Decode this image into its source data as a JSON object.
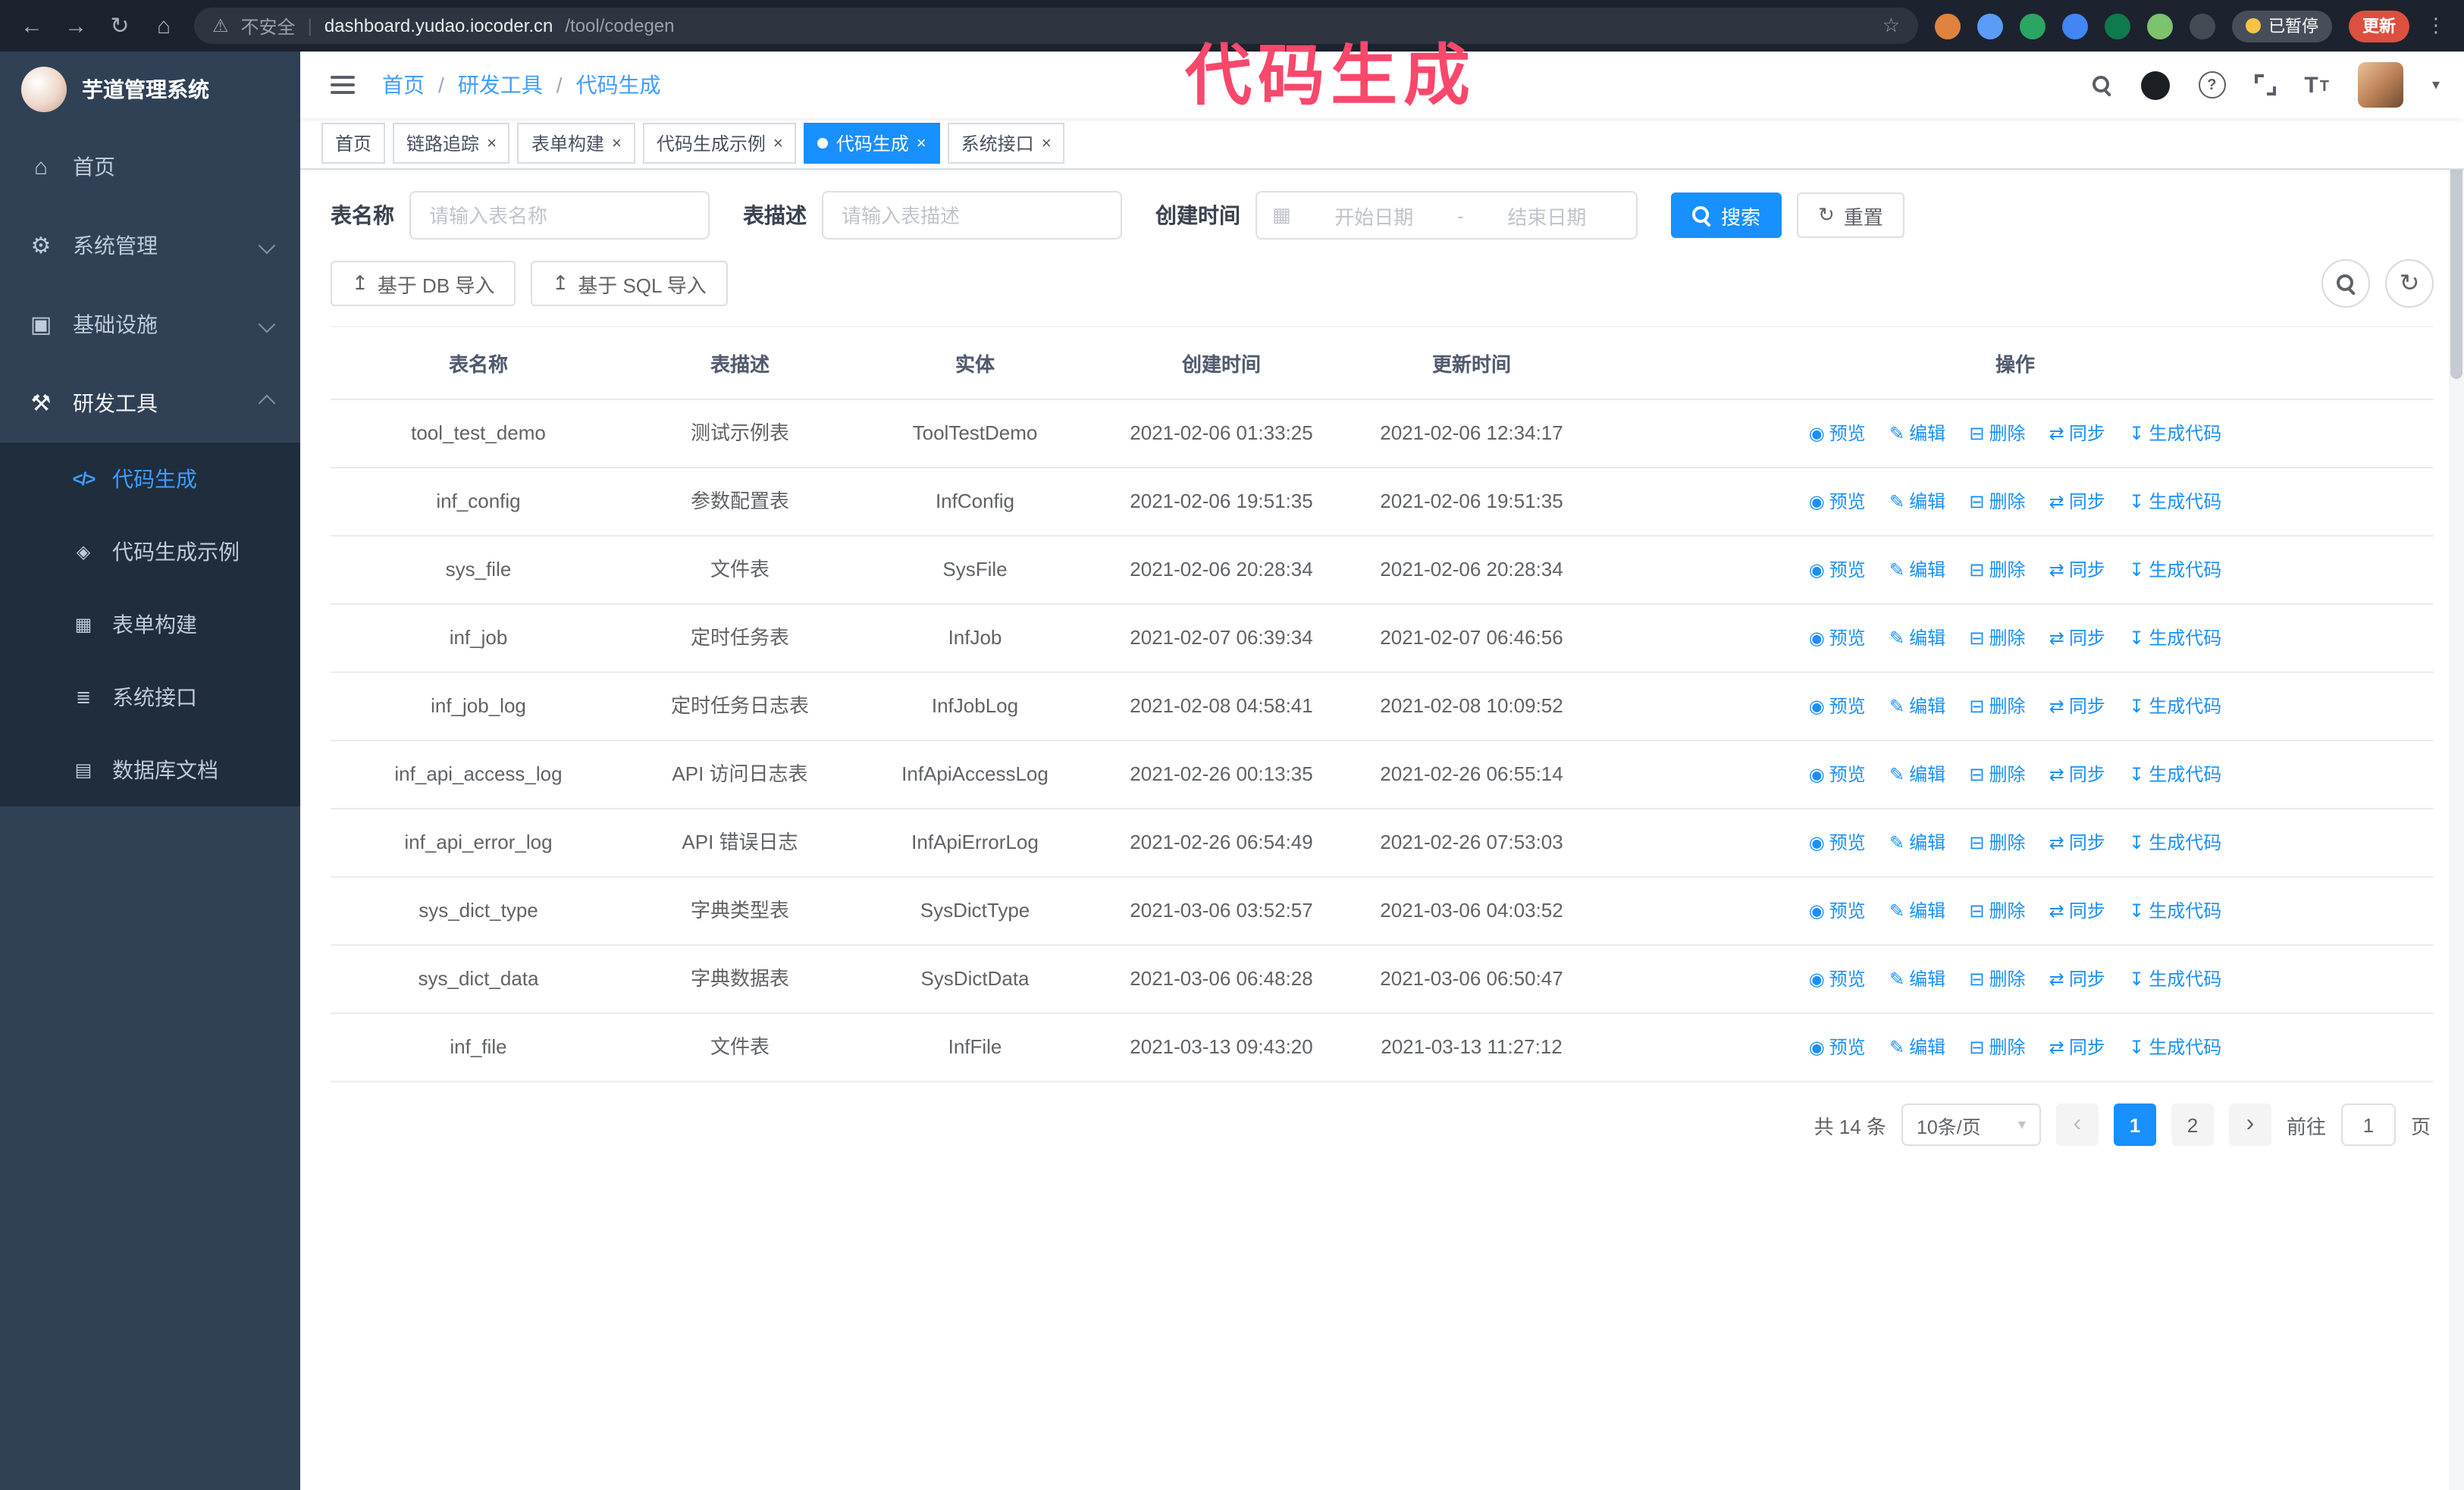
{
  "browser": {
    "security_label": "不安全",
    "url_host": "dashboard.yudao.iocoder.cn",
    "url_path": "/tool/codegen",
    "paused_badge": "已暂停",
    "update_button": "更新"
  },
  "annotation": {
    "text": "代码生成",
    "color": "#f8486c"
  },
  "theme": {
    "accent": "#1890ff",
    "sidebar_bg": "#304156",
    "submenu_bg": "#1f2d3d",
    "link_color": "#409eff",
    "annotation_color": "#f8486c"
  },
  "icons": {
    "back": "←",
    "forward": "→",
    "reload": "↻",
    "home": "⌂",
    "warning": "⚠",
    "star": "☆",
    "kebab": "⋮",
    "close": "×",
    "menu_home": "⌂",
    "menu_system": "⚙",
    "menu_infra": "▣",
    "menu_tools": "⚒",
    "menu_codegen": "</>",
    "menu_example": "◈",
    "menu_form": "▦",
    "menu_api": "≣",
    "menu_db": "▤",
    "calendar": "▦",
    "reset": "↻",
    "import": "↥",
    "refresh": "↻",
    "eye": "◉",
    "edit": "✎",
    "delete": "⊟",
    "sync": "⇄",
    "generate": "↧",
    "caret_down": "▾",
    "prev": "‹",
    "next": "›",
    "question": "?",
    "font_large": "T",
    "font_small": "T"
  },
  "sidebar": {
    "logo_title": "芋道管理系统",
    "items": [
      {
        "label": "首页",
        "expandable": false
      },
      {
        "label": "系统管理",
        "expandable": true,
        "expanded": false
      },
      {
        "label": "基础设施",
        "expandable": true,
        "expanded": false
      },
      {
        "label": "研发工具",
        "expandable": true,
        "expanded": true
      }
    ],
    "sub_items": [
      {
        "label": "代码生成",
        "active": true
      },
      {
        "label": "代码生成示例",
        "active": false
      },
      {
        "label": "表单构建",
        "active": false
      },
      {
        "label": "系统接口",
        "active": false
      },
      {
        "label": "数据库文档",
        "active": false
      }
    ]
  },
  "header": {
    "breadcrumb": [
      "首页",
      "研发工具",
      "代码生成"
    ],
    "separator": "/"
  },
  "tabs": [
    {
      "label": "首页",
      "closable": false,
      "active": false
    },
    {
      "label": "链路追踪",
      "closable": true,
      "active": false
    },
    {
      "label": "表单构建",
      "closable": true,
      "active": false
    },
    {
      "label": "代码生成示例",
      "closable": true,
      "active": false
    },
    {
      "label": "代码生成",
      "closable": true,
      "active": true
    },
    {
      "label": "系统接口",
      "closable": true,
      "active": false
    }
  ],
  "filters": {
    "table_name_label": "表名称",
    "table_name_placeholder": "请输入表名称",
    "table_desc_label": "表描述",
    "table_desc_placeholder": "请输入表描述",
    "create_time_label": "创建时间",
    "date_start_placeholder": "开始日期",
    "date_separator": "-",
    "date_end_placeholder": "结束日期",
    "search_button": "搜索",
    "reset_button": "重置"
  },
  "toolbar": {
    "import_db_button": "基于 DB 导入",
    "import_sql_button": "基于 SQL 导入"
  },
  "table": {
    "columns": [
      "表名称",
      "表描述",
      "实体",
      "创建时间",
      "更新时间",
      "操作"
    ],
    "actions": [
      "预览",
      "编辑",
      "删除",
      "同步",
      "生成代码"
    ],
    "rows": [
      {
        "name": "tool_test_demo",
        "desc": "测试示例表",
        "entity": "ToolTestDemo",
        "created": "2021-02-06 01:33:25",
        "updated": "2021-02-06 12:34:17"
      },
      {
        "name": "inf_config",
        "desc": "参数配置表",
        "entity": "InfConfig",
        "created": "2021-02-06 19:51:35",
        "updated": "2021-02-06 19:51:35"
      },
      {
        "name": "sys_file",
        "desc": "文件表",
        "entity": "SysFile",
        "created": "2021-02-06 20:28:34",
        "updated": "2021-02-06 20:28:34"
      },
      {
        "name": "inf_job",
        "desc": "定时任务表",
        "entity": "InfJob",
        "created": "2021-02-07 06:39:34",
        "updated": "2021-02-07 06:46:56"
      },
      {
        "name": "inf_job_log",
        "desc": "定时任务日志表",
        "entity": "InfJobLog",
        "created": "2021-02-08 04:58:41",
        "updated": "2021-02-08 10:09:52"
      },
      {
        "name": "inf_api_access_log",
        "desc": "API 访问日志表",
        "entity": "InfApiAccessLog",
        "created": "2021-02-26 00:13:35",
        "updated": "2021-02-26 06:55:14"
      },
      {
        "name": "inf_api_error_log",
        "desc": "API 错误日志",
        "entity": "InfApiErrorLog",
        "created": "2021-02-26 06:54:49",
        "updated": "2021-02-26 07:53:03"
      },
      {
        "name": "sys_dict_type",
        "desc": "字典类型表",
        "entity": "SysDictType",
        "created": "2021-03-06 03:52:57",
        "updated": "2021-03-06 04:03:52"
      },
      {
        "name": "sys_dict_data",
        "desc": "字典数据表",
        "entity": "SysDictData",
        "created": "2021-03-06 06:48:28",
        "updated": "2021-03-06 06:50:47"
      },
      {
        "name": "inf_file",
        "desc": "文件表",
        "entity": "InfFile",
        "created": "2021-03-13 09:43:20",
        "updated": "2021-03-13 11:27:12"
      }
    ]
  },
  "pagination": {
    "total_text": "共 14 条",
    "page_size": "10条/页",
    "pages": [
      "1",
      "2"
    ],
    "active_page": "1",
    "goto_label": "前往",
    "goto_value": "1",
    "goto_suffix": "页"
  }
}
